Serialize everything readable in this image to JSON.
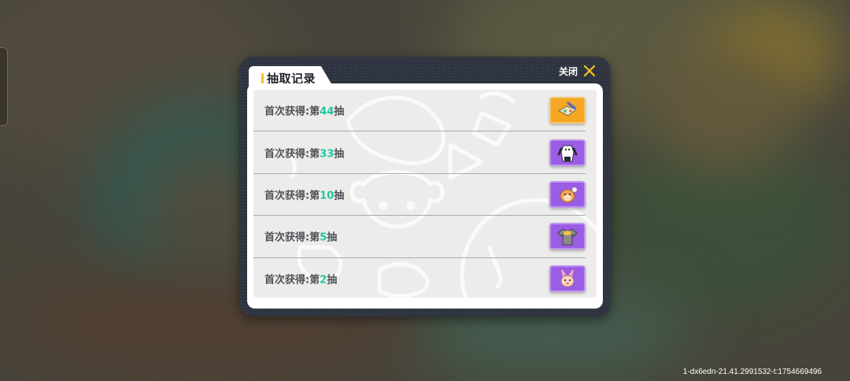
{
  "dialog": {
    "title": "抽取记录",
    "close_label": "关闭",
    "accent_color": "#f5c418",
    "number_color": "#1fc6a2"
  },
  "records": [
    {
      "prefix": "首次获得:第",
      "number": "44",
      "suffix": "抽",
      "rarity_color": "#f5a623",
      "item_icon": "map-scroll-icon"
    },
    {
      "prefix": "首次获得:第",
      "number": "33",
      "suffix": "抽",
      "rarity_color": "#9b5de5",
      "item_icon": "panda-suit-icon"
    },
    {
      "prefix": "首次获得:第",
      "number": "10",
      "suffix": "抽",
      "rarity_color": "#9b5de5",
      "item_icon": "hamster-plush-icon"
    },
    {
      "prefix": "首次获得:第",
      "number": "5",
      "suffix": "抽",
      "rarity_color": "#9b5de5",
      "item_icon": "shirt-icon"
    },
    {
      "prefix": "首次获得:第",
      "number": "2",
      "suffix": "抽",
      "rarity_color": "#9b5de5",
      "item_icon": "bunny-bag-icon"
    }
  ],
  "footer": {
    "build_info": "1-dx6edn-21.41.2991532-t:1754669496"
  }
}
